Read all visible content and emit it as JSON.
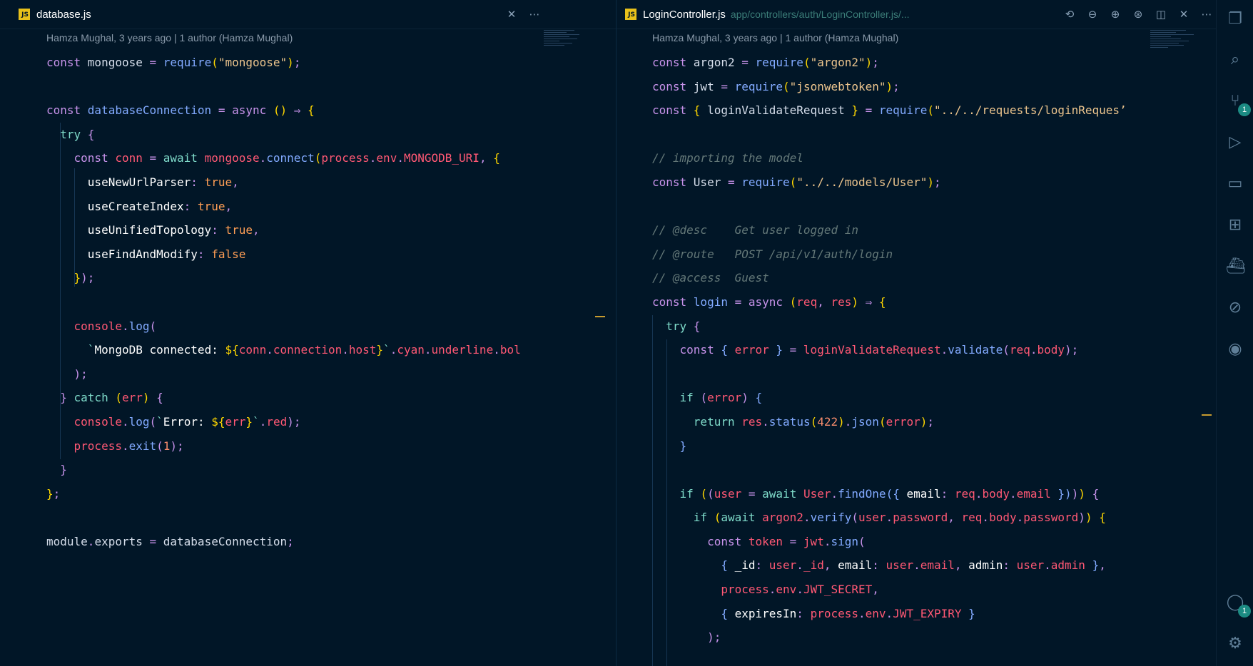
{
  "left": {
    "tab": {
      "name": "database.js",
      "icon": "JS"
    },
    "blame": "Hamza Mughal, 3 years ago | 1 author (Hamza Mughal)",
    "lines": [
      [
        [
          "k",
          "const "
        ],
        [
          "v",
          "mongoose "
        ],
        [
          "k",
          "= "
        ],
        [
          "f",
          "require"
        ],
        [
          "y",
          "("
        ],
        [
          "s",
          "\"mongoose\""
        ],
        [
          "y",
          ")"
        ],
        [
          "k",
          ";"
        ]
      ],
      [],
      [
        [
          "k",
          "const "
        ],
        [
          "f",
          "databaseConnection "
        ],
        [
          "k",
          "= "
        ],
        [
          "k",
          "async "
        ],
        [
          "y",
          "() "
        ],
        [
          "k",
          "⇒ "
        ],
        [
          "y",
          "{"
        ]
      ],
      [
        [
          "v",
          "  "
        ],
        [
          "p",
          "try "
        ],
        [
          "k",
          "{"
        ]
      ],
      [
        [
          "v",
          "    "
        ],
        [
          "k",
          "const "
        ],
        [
          "r",
          "conn "
        ],
        [
          "k",
          "= "
        ],
        [
          "p",
          "await "
        ],
        [
          "r",
          "mongoose"
        ],
        [
          "k",
          "."
        ],
        [
          "f",
          "connect"
        ],
        [
          "y",
          "("
        ],
        [
          "r",
          "process"
        ],
        [
          "k",
          "."
        ],
        [
          "r",
          "env"
        ],
        [
          "k",
          "."
        ],
        [
          "r",
          "MONGODB_URI"
        ],
        [
          "k",
          ", "
        ],
        [
          "y",
          "{"
        ]
      ],
      [
        [
          "v",
          "      "
        ],
        [
          "w",
          "useNewUrlParser"
        ],
        [
          "k",
          ": "
        ],
        [
          "b",
          "true"
        ],
        [
          "k",
          ","
        ]
      ],
      [
        [
          "v",
          "      "
        ],
        [
          "w",
          "useCreateIndex"
        ],
        [
          "k",
          ": "
        ],
        [
          "b",
          "true"
        ],
        [
          "k",
          ","
        ]
      ],
      [
        [
          "v",
          "      "
        ],
        [
          "w",
          "useUnifiedTopology"
        ],
        [
          "k",
          ": "
        ],
        [
          "b",
          "true"
        ],
        [
          "k",
          ","
        ]
      ],
      [
        [
          "v",
          "      "
        ],
        [
          "w",
          "useFindAndModify"
        ],
        [
          "k",
          ": "
        ],
        [
          "b",
          "false"
        ]
      ],
      [
        [
          "v",
          "    "
        ],
        [
          "y",
          "}"
        ],
        [
          "k",
          ");"
        ]
      ],
      [],
      [
        [
          "v",
          "    "
        ],
        [
          "r",
          "console"
        ],
        [
          "k",
          "."
        ],
        [
          "f",
          "log"
        ],
        [
          "k",
          "("
        ]
      ],
      [
        [
          "v",
          "      "
        ],
        [
          "p",
          "`"
        ],
        [
          "w",
          "MongoDB connected: "
        ],
        [
          "y",
          "${"
        ],
        [
          "r",
          "conn"
        ],
        [
          "k",
          "."
        ],
        [
          "r",
          "connection"
        ],
        [
          "k",
          "."
        ],
        [
          "r",
          "host"
        ],
        [
          "y",
          "}"
        ],
        [
          "p",
          "`"
        ],
        [
          "k",
          "."
        ],
        [
          "r",
          "cyan"
        ],
        [
          "k",
          "."
        ],
        [
          "r",
          "underline"
        ],
        [
          "k",
          "."
        ],
        [
          "r",
          "bol"
        ]
      ],
      [
        [
          "v",
          "    "
        ],
        [
          "k",
          ");"
        ]
      ],
      [
        [
          "v",
          "  "
        ],
        [
          "k",
          "} "
        ],
        [
          "p",
          "catch "
        ],
        [
          "y",
          "("
        ],
        [
          "r",
          "err"
        ],
        [
          "y",
          ") "
        ],
        [
          "k",
          "{"
        ]
      ],
      [
        [
          "v",
          "    "
        ],
        [
          "r",
          "console"
        ],
        [
          "k",
          "."
        ],
        [
          "f",
          "log"
        ],
        [
          "k",
          "("
        ],
        [
          "p",
          "`"
        ],
        [
          "w",
          "Error: "
        ],
        [
          "y",
          "${"
        ],
        [
          "r",
          "err"
        ],
        [
          "y",
          "}"
        ],
        [
          "p",
          "`"
        ],
        [
          "k",
          "."
        ],
        [
          "r",
          "red"
        ],
        [
          "k",
          ");"
        ]
      ],
      [
        [
          "v",
          "    "
        ],
        [
          "r",
          "process"
        ],
        [
          "k",
          "."
        ],
        [
          "f",
          "exit"
        ],
        [
          "k",
          "("
        ],
        [
          "n",
          "1"
        ],
        [
          "k",
          ");"
        ]
      ],
      [
        [
          "v",
          "  "
        ],
        [
          "k",
          "}"
        ]
      ],
      [
        [
          "y",
          "}"
        ],
        [
          "k",
          ";"
        ]
      ],
      [],
      [
        [
          "v",
          "module"
        ],
        [
          "k",
          "."
        ],
        [
          "v",
          "exports "
        ],
        [
          "k",
          "= "
        ],
        [
          "v",
          "databaseConnection"
        ],
        [
          "k",
          ";"
        ]
      ]
    ]
  },
  "right": {
    "tab": {
      "name": "LoginController.js",
      "path": "app/controllers/auth/LoginController.js/...",
      "icon": "JS"
    },
    "blame": "Hamza Mughal, 3 years ago | 1 author (Hamza Mughal)",
    "lines": [
      [
        [
          "k",
          "const "
        ],
        [
          "v",
          "argon2 "
        ],
        [
          "k",
          "= "
        ],
        [
          "f",
          "require"
        ],
        [
          "y",
          "("
        ],
        [
          "s",
          "\"argon2\""
        ],
        [
          "y",
          ")"
        ],
        [
          "k",
          ";"
        ]
      ],
      [
        [
          "k",
          "const "
        ],
        [
          "v",
          "jwt "
        ],
        [
          "k",
          "= "
        ],
        [
          "f",
          "require"
        ],
        [
          "y",
          "("
        ],
        [
          "s",
          "\"jsonwebtoken\""
        ],
        [
          "y",
          ")"
        ],
        [
          "k",
          ";"
        ]
      ],
      [
        [
          "k",
          "const "
        ],
        [
          "y",
          "{ "
        ],
        [
          "v",
          "loginValidateRequest "
        ],
        [
          "y",
          "} "
        ],
        [
          "k",
          "= "
        ],
        [
          "f",
          "require"
        ],
        [
          "y",
          "("
        ],
        [
          "s",
          "\"../../requests/loginReques’"
        ]
      ],
      [],
      [
        [
          "c",
          "// importing the model"
        ]
      ],
      [
        [
          "k",
          "const "
        ],
        [
          "v",
          "User "
        ],
        [
          "k",
          "= "
        ],
        [
          "f",
          "require"
        ],
        [
          "y",
          "("
        ],
        [
          "s",
          "\"../../models/User\""
        ],
        [
          "y",
          ")"
        ],
        [
          "k",
          ";"
        ]
      ],
      [],
      [
        [
          "c",
          "// @desc    Get user logged in"
        ]
      ],
      [
        [
          "c",
          "// @route   POST /api/v1/auth/login"
        ]
      ],
      [
        [
          "c",
          "// @access  Guest"
        ]
      ],
      [
        [
          "k",
          "const "
        ],
        [
          "f",
          "login "
        ],
        [
          "k",
          "= "
        ],
        [
          "k",
          "async "
        ],
        [
          "y",
          "("
        ],
        [
          "r",
          "req"
        ],
        [
          "k",
          ", "
        ],
        [
          "r",
          "res"
        ],
        [
          "y",
          ") "
        ],
        [
          "k",
          "⇒ "
        ],
        [
          "y",
          "{"
        ]
      ],
      [
        [
          "v",
          "  "
        ],
        [
          "p",
          "try "
        ],
        [
          "k",
          "{"
        ]
      ],
      [
        [
          "v",
          "    "
        ],
        [
          "k",
          "const "
        ],
        [
          "f",
          "{ "
        ],
        [
          "r",
          "error "
        ],
        [
          "f",
          "} "
        ],
        [
          "k",
          "= "
        ],
        [
          "r",
          "loginValidateRequest"
        ],
        [
          "k",
          "."
        ],
        [
          "f",
          "validate"
        ],
        [
          "k",
          "("
        ],
        [
          "r",
          "req"
        ],
        [
          "k",
          "."
        ],
        [
          "r",
          "body"
        ],
        [
          "k",
          ");"
        ]
      ],
      [],
      [
        [
          "v",
          "    "
        ],
        [
          "p",
          "if "
        ],
        [
          "k",
          "("
        ],
        [
          "r",
          "error"
        ],
        [
          "k",
          ") "
        ],
        [
          "f",
          "{"
        ]
      ],
      [
        [
          "v",
          "      "
        ],
        [
          "p",
          "return "
        ],
        [
          "r",
          "res"
        ],
        [
          "k",
          "."
        ],
        [
          "f",
          "status"
        ],
        [
          "y",
          "("
        ],
        [
          "n",
          "422"
        ],
        [
          "y",
          ")"
        ],
        [
          "k",
          "."
        ],
        [
          "f",
          "json"
        ],
        [
          "y",
          "("
        ],
        [
          "r",
          "error"
        ],
        [
          "y",
          ")"
        ],
        [
          "k",
          ";"
        ]
      ],
      [
        [
          "v",
          "    "
        ],
        [
          "f",
          "}"
        ]
      ],
      [],
      [
        [
          "v",
          "    "
        ],
        [
          "p",
          "if "
        ],
        [
          "y",
          "("
        ],
        [
          "k",
          "("
        ],
        [
          "r",
          "user "
        ],
        [
          "k",
          "= "
        ],
        [
          "p",
          "await "
        ],
        [
          "r",
          "User"
        ],
        [
          "k",
          "."
        ],
        [
          "f",
          "findOne"
        ],
        [
          "f",
          "({ "
        ],
        [
          "w",
          "email"
        ],
        [
          "k",
          ": "
        ],
        [
          "r",
          "req"
        ],
        [
          "k",
          "."
        ],
        [
          "r",
          "body"
        ],
        [
          "k",
          "."
        ],
        [
          "r",
          "email "
        ],
        [
          "f",
          "})"
        ],
        [
          "k",
          ")"
        ],
        [
          "y",
          ") "
        ],
        [
          "k",
          "{"
        ]
      ],
      [
        [
          "v",
          "      "
        ],
        [
          "p",
          "if "
        ],
        [
          "y",
          "("
        ],
        [
          "p",
          "await "
        ],
        [
          "r",
          "argon2"
        ],
        [
          "k",
          "."
        ],
        [
          "f",
          "verify"
        ],
        [
          "k",
          "("
        ],
        [
          "r",
          "user"
        ],
        [
          "k",
          "."
        ],
        [
          "r",
          "password"
        ],
        [
          "k",
          ", "
        ],
        [
          "r",
          "req"
        ],
        [
          "k",
          "."
        ],
        [
          "r",
          "body"
        ],
        [
          "k",
          "."
        ],
        [
          "r",
          "password"
        ],
        [
          "k",
          ")"
        ],
        [
          "y",
          ") {"
        ]
      ],
      [
        [
          "v",
          "        "
        ],
        [
          "k",
          "const "
        ],
        [
          "r",
          "token "
        ],
        [
          "k",
          "= "
        ],
        [
          "r",
          "jwt"
        ],
        [
          "k",
          "."
        ],
        [
          "f",
          "sign"
        ],
        [
          "k",
          "("
        ]
      ],
      [
        [
          "v",
          "          "
        ],
        [
          "f",
          "{ "
        ],
        [
          "w",
          "_id"
        ],
        [
          "k",
          ": "
        ],
        [
          "r",
          "user"
        ],
        [
          "k",
          "."
        ],
        [
          "r",
          "_id"
        ],
        [
          "k",
          ", "
        ],
        [
          "w",
          "email"
        ],
        [
          "k",
          ": "
        ],
        [
          "r",
          "user"
        ],
        [
          "k",
          "."
        ],
        [
          "r",
          "email"
        ],
        [
          "k",
          ", "
        ],
        [
          "w",
          "admin"
        ],
        [
          "k",
          ": "
        ],
        [
          "r",
          "user"
        ],
        [
          "k",
          "."
        ],
        [
          "r",
          "admin "
        ],
        [
          "f",
          "}"
        ],
        [
          "k",
          ","
        ]
      ],
      [
        [
          "v",
          "          "
        ],
        [
          "r",
          "process"
        ],
        [
          "k",
          "."
        ],
        [
          "r",
          "env"
        ],
        [
          "k",
          "."
        ],
        [
          "r",
          "JWT_SECRET"
        ],
        [
          "k",
          ","
        ]
      ],
      [
        [
          "v",
          "          "
        ],
        [
          "f",
          "{ "
        ],
        [
          "w",
          "expiresIn"
        ],
        [
          "k",
          ": "
        ],
        [
          "r",
          "process"
        ],
        [
          "k",
          "."
        ],
        [
          "r",
          "env"
        ],
        [
          "k",
          "."
        ],
        [
          "r",
          "JWT_EXPIRY "
        ],
        [
          "f",
          "}"
        ]
      ],
      [
        [
          "v",
          "        "
        ],
        [
          "k",
          ");"
        ]
      ]
    ]
  },
  "activity_bar": {
    "source_control_badge": "1",
    "accounts_badge": "1"
  }
}
